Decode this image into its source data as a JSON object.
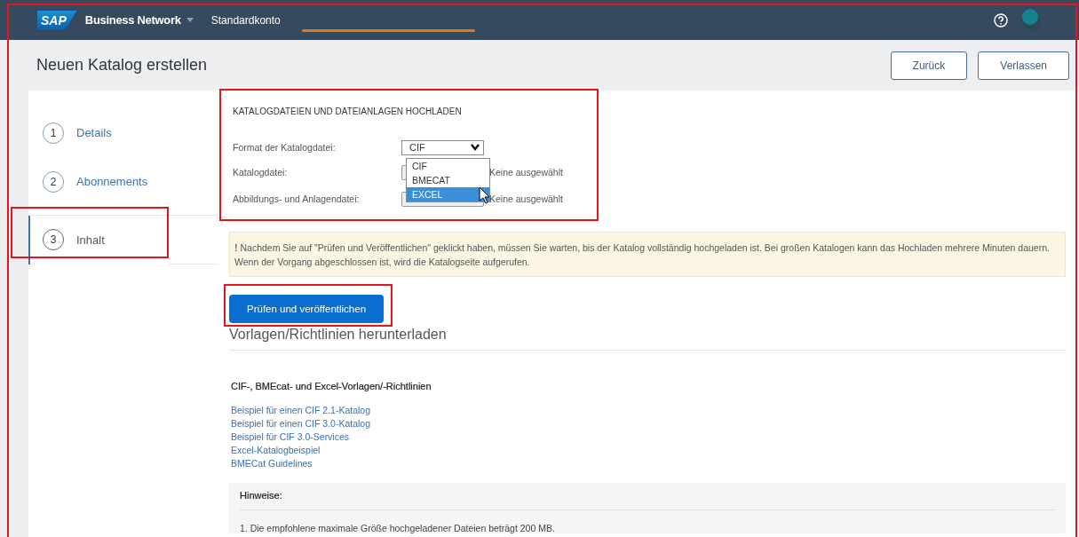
{
  "header": {
    "logo": "SAP",
    "product": "Business Network",
    "account": "Standardkonto"
  },
  "page": {
    "title": "Neuen Katalog erstellen",
    "highlighted": true,
    "buttons": [
      "Zurück",
      "Verlassen"
    ]
  },
  "steps": [
    {
      "number": "1",
      "label": "Details",
      "selected": false,
      "highlighted": false
    },
    {
      "number": "2",
      "label": "Abonnements",
      "selected": false,
      "highlighted": false
    },
    {
      "number": "3",
      "label": "Inhalt",
      "selected": true,
      "highlighted": true
    }
  ],
  "upload": {
    "title": "KATALOGDATEIEN UND DATEIANLAGEN HOCHLADEN",
    "highlighted": true,
    "format_label": "Format der Katalogdatei:",
    "format_value": "CIF",
    "dropdown_open": true,
    "options": [
      {
        "label": "CIF",
        "selected": false
      },
      {
        "label": "BMECAT",
        "selected": false
      },
      {
        "label": "EXCEL",
        "selected": true
      }
    ],
    "files": [
      {
        "label": "Katalogdatei:",
        "status": "Keine ausgewählt"
      },
      {
        "label": "Abbildungs- und Anlagendatei:",
        "status": "Keine ausgewählt"
      }
    ]
  },
  "notice": {
    "mark": "!",
    "text": "Nachdem Sie auf \"Prüfen und Veröffentlichen\" geklickt haben, müssen Sie warten, bis der Katalog vollständig hochgeladen ist. Bei großen Katalogen kann das Hochladen mehrere Minuten dauern. Wenn der Vorgang abgeschlossen ist, wird die Katalogseite aufgerufen."
  },
  "publish_button": {
    "label": "Prüfen und veröffentlichen",
    "highlighted": true
  },
  "downloads": {
    "title": "Vorlagen/Richtlinien herunterladen",
    "subtitle": "CIF-, BMEcat- und Excel-Vorlagen/-Richtlinien",
    "links": [
      "Beispiel für einen CIF 2.1-Katalog",
      "Beispiel für einen CIF 3.0-Katalog",
      "Beispiel für CIF 3.0-Services",
      "Excel-Katalogbeispiel",
      "BMECat Guidelines"
    ]
  },
  "notes": {
    "title": "Hinweise:",
    "items": [
      "1. Die empfohlene maximale Größe hochgeladener Dateien beträgt 200 MB."
    ]
  }
}
